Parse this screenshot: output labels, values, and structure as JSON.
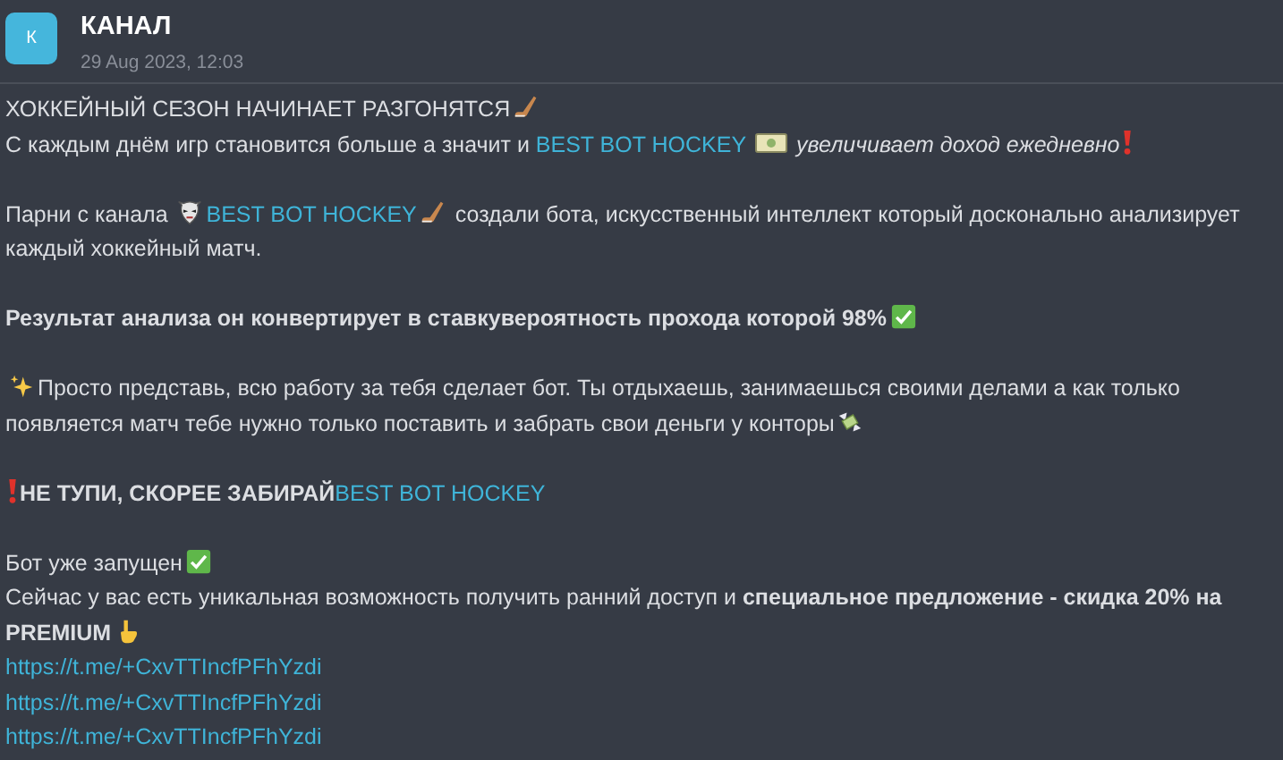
{
  "header": {
    "avatar_letter": "К",
    "name": "КАНАЛ",
    "date": "29 Aug 2023, 12:03"
  },
  "paragraphs": [
    [
      {
        "kind": "text",
        "text": "ХОККЕЙНЫЙ СЕЗОН НАЧИНАЕТ РАЗГОНЯТСЯ"
      },
      {
        "kind": "stick"
      },
      {
        "kind": "break"
      },
      {
        "kind": "text",
        "text": "С каждым днём игр становится больше а значит и "
      },
      {
        "kind": "link",
        "text": "BEST BOT HOCKEY"
      },
      {
        "kind": "ticket"
      },
      {
        "kind": "italic",
        "text": "увеличивает доход ежедневно"
      },
      {
        "kind": "exclaim"
      }
    ],
    [
      {
        "kind": "text",
        "text": "Парни с канала "
      },
      {
        "kind": "mask"
      },
      {
        "kind": "link",
        "text": "BEST BOT HOCKEY"
      },
      {
        "kind": "stick"
      },
      {
        "kind": "text",
        "text": " создали бота, искусственный интеллект который досконально анализирует"
      },
      {
        "kind": "break"
      },
      {
        "kind": "text",
        "text": "каждый хоккейный матч."
      }
    ],
    [
      {
        "kind": "bold",
        "text": "Результат анализа он конвертирует в ставкувероятность прохода которой 98%"
      },
      {
        "kind": "check"
      }
    ],
    [
      {
        "kind": "sparkles"
      },
      {
        "kind": "text",
        "text": "Просто представь, всю работу за тебя сделает бот. Ты отдыхаешь, занимаешься своими делами а как только"
      },
      {
        "kind": "break"
      },
      {
        "kind": "text",
        "text": "появляется матч тебе нужно только поставить и забрать свои деньги у конторы"
      },
      {
        "kind": "money"
      }
    ],
    [
      {
        "kind": "exclaim"
      },
      {
        "kind": "bold",
        "text": "НЕ ТУПИ, СКОРЕЕ ЗАБИРАЙ"
      },
      {
        "kind": "link",
        "text": "BEST BOT HOCKEY"
      }
    ],
    [
      {
        "kind": "text",
        "text": "Бот уже запущен"
      },
      {
        "kind": "check"
      },
      {
        "kind": "break"
      },
      {
        "kind": "text",
        "text": "Сейчас у вас есть уникальная возможность получить ранний доступ и "
      },
      {
        "kind": "bold",
        "text": "специальное предложение - скидка 20% на"
      },
      {
        "kind": "break"
      },
      {
        "kind": "bold",
        "text": "PREMIUM"
      },
      {
        "kind": "point"
      },
      {
        "kind": "break"
      },
      {
        "kind": "link",
        "text": "https://t.me/+CxvTTIncfPFhYzdi"
      },
      {
        "kind": "break"
      },
      {
        "kind": "link",
        "text": "https://t.me/+CxvTTIncfPFhYzdi"
      },
      {
        "kind": "break"
      },
      {
        "kind": "link",
        "text": "https://t.me/+CxvTTIncfPFhYzdi"
      }
    ]
  ]
}
